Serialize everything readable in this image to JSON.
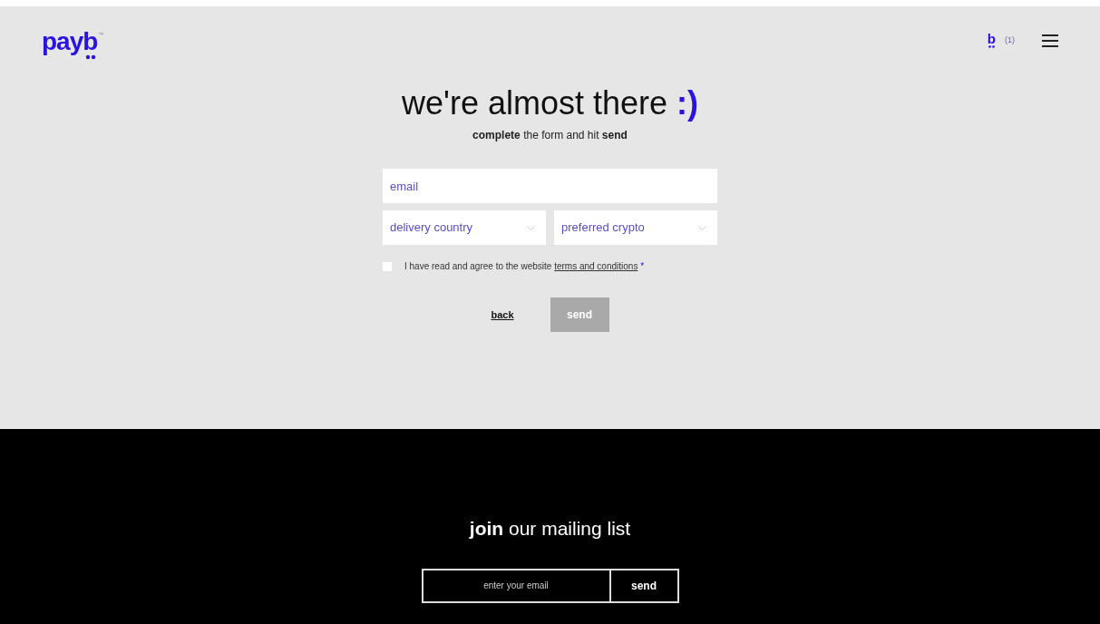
{
  "header": {
    "logo": "payb",
    "trademark": "™",
    "cart_letter": "b",
    "cart_count": "(1)"
  },
  "form": {
    "title": "we're almost there",
    "title_emoticon": ":)",
    "subtitle": "**complete** the form and hit **send**",
    "email": {
      "placeholder": "email"
    },
    "selects": [
      {
        "placeholder": "delivery country"
      },
      {
        "placeholder": "preferred crypto"
      }
    ],
    "agree": {
      "checked": false,
      "text": "I have read and agree to the website",
      "link": "terms and conditions",
      "required_mark": "*"
    },
    "back": "back",
    "send": {
      "label": "send",
      "disabled": true
    }
  },
  "footer": {
    "title": "**join** our mailing list",
    "email": {
      "placeholder": "enter your email"
    },
    "send": "send"
  }
}
